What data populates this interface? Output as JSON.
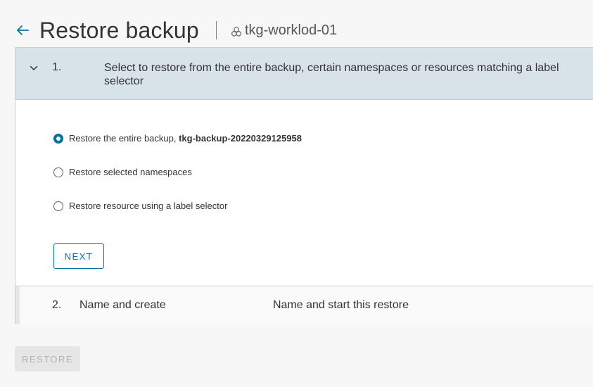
{
  "header": {
    "title": "Restore backup",
    "cluster_name": "tkg-worklod-01"
  },
  "wizard": {
    "step1": {
      "number": "1.",
      "description": "Select to restore from the entire backup, certain namespaces or resources matching a label selector",
      "options": [
        {
          "label": "Restore the entire backup, ",
          "emphasis": "tkg-backup-20220329125958",
          "selected": true
        },
        {
          "label": "Restore selected namespaces",
          "emphasis": "",
          "selected": false
        },
        {
          "label": "Restore resource using a label selector",
          "emphasis": "",
          "selected": false
        }
      ],
      "next_label": "NEXT"
    },
    "step2": {
      "number": "2.",
      "title": "Name and create",
      "description": "Name and start this restore"
    }
  },
  "footer": {
    "restore_label": "RESTORE"
  },
  "colors": {
    "accent": "#0072a3",
    "step_header_bg": "#d8e3e9",
    "disabled_bg": "#e6e6e6",
    "disabled_text": "#b3b3b3"
  },
  "icons": {
    "back": "arrow-left-icon",
    "cluster": "cluster-icon",
    "collapse": "chevron-down-icon"
  }
}
